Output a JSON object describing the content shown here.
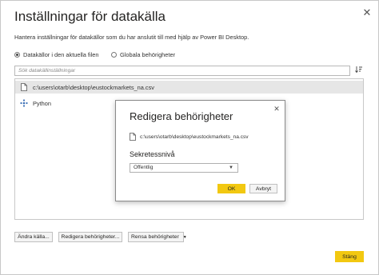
{
  "window": {
    "title": "Inställningar för datakälla",
    "close_glyph": "✕",
    "description": "Hantera inställningar för datakällor som du har anslutit till med hjälp av Power BI Desktop."
  },
  "scope": {
    "option_current": "Datakällor i den aktuella filen",
    "option_global": "Globala behörigheter",
    "selected": "current"
  },
  "search": {
    "placeholder": "Sök datakällinställningar",
    "sort_icon": "sort-icon"
  },
  "sources": [
    {
      "label": "c:\\users\\otarb\\desktop\\eustockmarkets_na.csv",
      "icon": "file-icon",
      "selected": true
    },
    {
      "label": "Python",
      "icon": "python-icon",
      "selected": false
    }
  ],
  "buttons": {
    "change_source": "Ändra källa...",
    "edit_permissions": "Redigera behörigheter...",
    "clear_permissions": "Rensa behörigheter",
    "close": "Stäng"
  },
  "dialog": {
    "title": "Redigera behörigheter",
    "close_glyph": "✕",
    "file_path": "c:\\users\\otarb\\desktop\\eustockmarkets_na.csv",
    "privacy_label": "Sekretessnivå",
    "privacy_value": "Offentlig",
    "ok": "OK",
    "cancel": "Avbryt"
  },
  "colors": {
    "accent_yellow": "#f2c811",
    "selection_gray": "#e6e6e6"
  }
}
